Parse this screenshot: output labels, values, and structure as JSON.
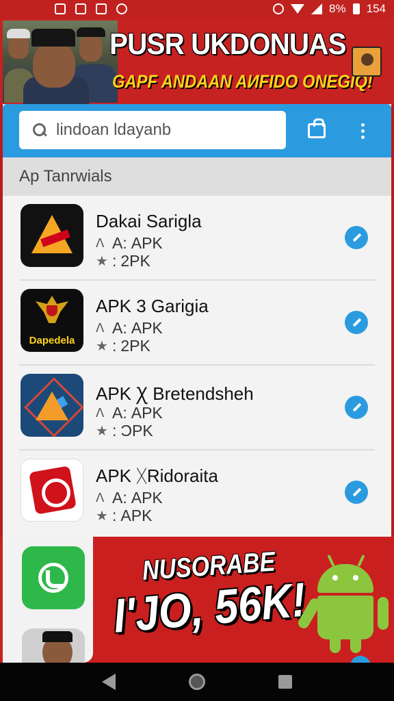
{
  "status_bar": {
    "battery_percent": "8%",
    "time": "154"
  },
  "banner": {
    "title": "PUSR UKDONUAS",
    "subtitle": "GAPF ANDAAN AИFIDO ONEGIQ!"
  },
  "search": {
    "query": "lindoan ldayanb",
    "icon": "search-icon"
  },
  "section": {
    "title": "Ap Tanrwials"
  },
  "apps": [
    {
      "name": "Dakai Sarigla",
      "developer": "APK",
      "rating": "2PK",
      "icon": "triangle-logo-icon"
    },
    {
      "name": "APK 3 Garigia",
      "developer": "APK",
      "rating": "2PK",
      "icon": "garuda-emblem-icon",
      "icon_label": "Dapedela"
    },
    {
      "name": "APK Ꭓ Bretendsheh",
      "developer": "APK",
      "rating": "ϽPK",
      "icon": "diamond-logo-icon"
    },
    {
      "name": "APK ᚷRidoraita",
      "developer": "APK",
      "rating": "APK",
      "icon": "red-sticker-icon"
    }
  ],
  "meta_prefixes": {
    "developer": "A: ",
    "rating": ": "
  },
  "promo": {
    "line1": "NUSORABE",
    "line2": "I'JO, 56K!"
  },
  "colors": {
    "brand_red": "#c62222",
    "accent_blue": "#2b9be0",
    "banner_yellow": "#ffd21a",
    "android_green": "#8cc63f"
  }
}
